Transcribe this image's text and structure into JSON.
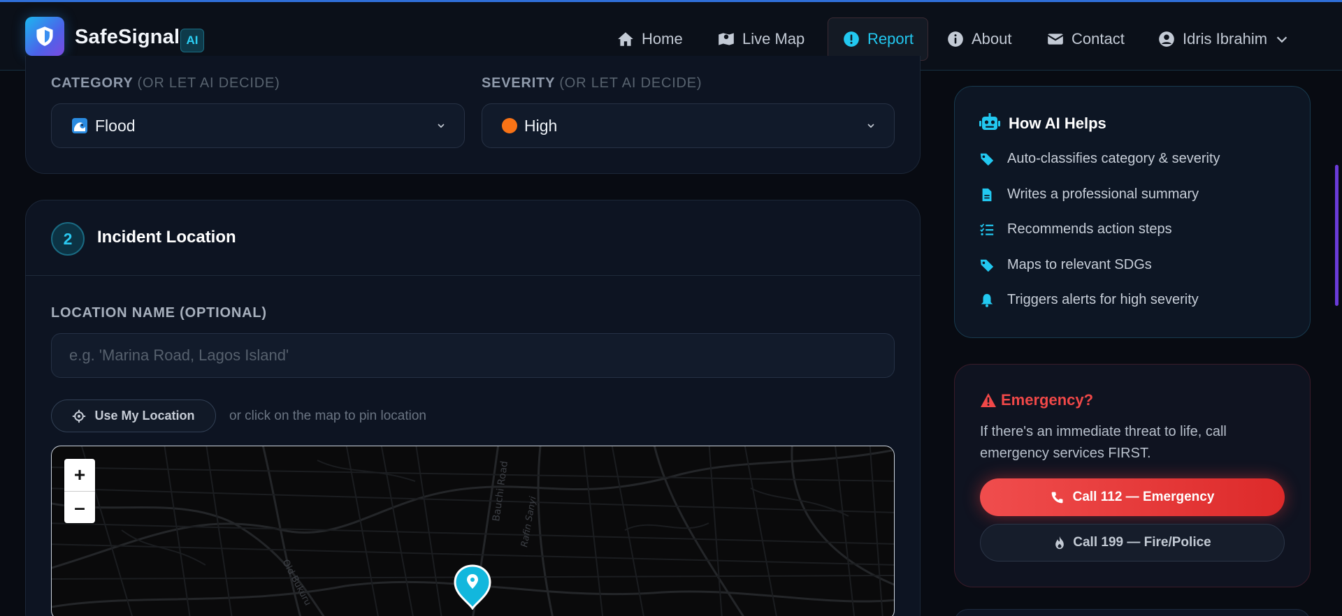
{
  "header": {
    "brand": "SafeSignal",
    "ai_badge": "AI",
    "nav": [
      {
        "label": "Home",
        "icon": "home-icon"
      },
      {
        "label": "Live Map",
        "icon": "map-icon"
      },
      {
        "label": "Report",
        "icon": "exclamation-circle-icon",
        "active": true
      },
      {
        "label": "About",
        "icon": "info-circle-icon"
      },
      {
        "label": "Contact",
        "icon": "envelope-icon"
      }
    ],
    "user": {
      "name": "Idris Ibrahim",
      "icon": "user-circle-icon"
    }
  },
  "form": {
    "category_label": "CATEGORY",
    "category_hint": "(OR LET AI DECIDE)",
    "category_value": "Flood",
    "category_icon": "wave-icon",
    "severity_label": "SEVERITY",
    "severity_hint": "(OR LET AI DECIDE)",
    "severity_value": "High",
    "severity_color": "#f97316",
    "step_number": "2",
    "section_title": "Incident Location",
    "location_label": "LOCATION NAME (OPTIONAL)",
    "location_placeholder": "e.g. 'Marina Road, Lagos Island'",
    "use_location_label": "Use My Location",
    "map_hint": "or click on the map to pin location",
    "map": {
      "zoom_in": "+",
      "zoom_out": "–",
      "street_labels": [
        "Bauchi Road",
        "Rafin Sanyi",
        "Old Bukuru"
      ],
      "pin_color": "#12b7dd"
    }
  },
  "ai_helps": {
    "title": "How AI Helps",
    "items": [
      {
        "text": "Auto-classifies category & severity",
        "icon": "tag-icon"
      },
      {
        "text": "Writes a professional summary",
        "icon": "document-icon"
      },
      {
        "text": "Recommends action steps",
        "icon": "list-check-icon"
      },
      {
        "text": "Maps to relevant SDGs",
        "icon": "tag-icon"
      },
      {
        "text": "Triggers alerts for high severity",
        "icon": "bell-icon"
      }
    ]
  },
  "emergency": {
    "title": "Emergency?",
    "text": "If there's an immediate threat to life, call emergency services FIRST.",
    "call_emergency": "Call 112 — Emergency",
    "call_fire": "Call 199 — Fire/Police"
  },
  "colors": {
    "accent": "#22c8f0",
    "danger": "#f04848",
    "background": "#080b12"
  }
}
